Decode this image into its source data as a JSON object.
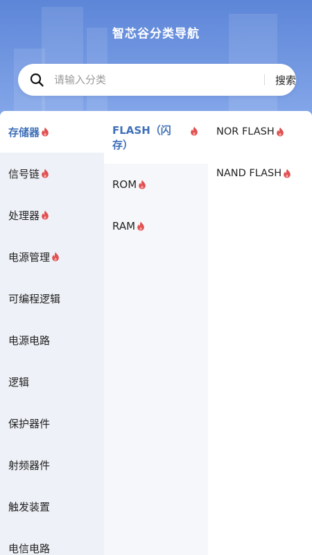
{
  "header": {
    "title": "智芯谷分类导航"
  },
  "search": {
    "placeholder": "请输入分类",
    "button_label": "搜索"
  },
  "colors": {
    "header_blue": "#6a8fdc",
    "active_text": "#3f6fb8",
    "fire": "#e05050"
  },
  "categories": [
    {
      "label": "存储器",
      "hot": true,
      "active": true
    },
    {
      "label": "信号链",
      "hot": true
    },
    {
      "label": "处理器",
      "hot": true
    },
    {
      "label": "电源管理",
      "hot": true
    },
    {
      "label": "可编程逻辑"
    },
    {
      "label": "电源电路"
    },
    {
      "label": "逻辑"
    },
    {
      "label": "保护器件"
    },
    {
      "label": "射频器件"
    },
    {
      "label": "触发装置"
    },
    {
      "label": "电信电路"
    }
  ],
  "subcategories": [
    {
      "label": "FLASH（闪存）",
      "hot": true,
      "active": true
    },
    {
      "label": "ROM",
      "hot": true
    },
    {
      "label": "RAM",
      "hot": true
    }
  ],
  "leaves": [
    {
      "label": "NOR FLASH",
      "hot": true
    },
    {
      "label": "NAND FLASH",
      "hot": true
    }
  ],
  "icons": {
    "search": "search-icon",
    "hot": "fire-icon"
  }
}
